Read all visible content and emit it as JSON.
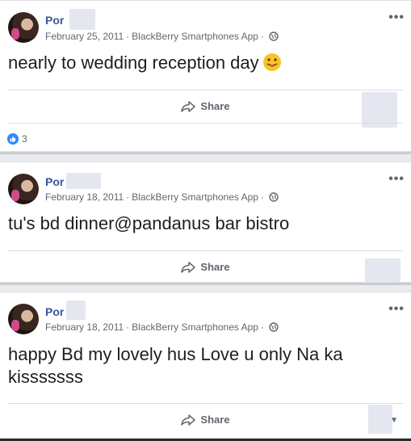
{
  "posts": [
    {
      "author": "Por",
      "date": "February 25, 2011",
      "app": "BlackBerry Smartphones App",
      "privacy_icon": "globe-icon",
      "text": "nearly to wedding reception day",
      "emoji": "tongue-out-emoji",
      "share_label": "Share",
      "reaction_count": "3"
    },
    {
      "author": "Por",
      "date": "February 18, 2011",
      "app": "BlackBerry Smartphones App",
      "privacy_icon": "globe-icon",
      "text": "tu's bd dinner@pandanus bar bistro",
      "share_label": "Share"
    },
    {
      "author": "Por",
      "date": "February 18, 2011",
      "app": "BlackBerry Smartphones App",
      "privacy_icon": "globe-icon",
      "text": "happy Bd my lovely hus Love u only Na ka kisssssss",
      "share_label": "Share"
    }
  ],
  "colors": {
    "author": "#365899",
    "like_badge": "#2d88ff",
    "feed_bg": "#e9ebee"
  }
}
